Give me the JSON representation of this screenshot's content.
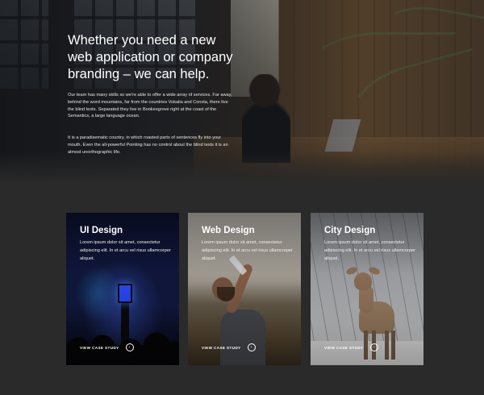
{
  "hero": {
    "headline": "Whether you need a new web application or company branding – we can help.",
    "paragraph1": "Our team has many skills so we're able to offer a wide array of services. Far away, behind the word mountains, far from the countries Vokalia and Consta, there live the blind texts. Separated they live in Bookesgrove right at the coast of the Semantics, a large language ocean.",
    "paragraph2": "It is a paradisematic country, in which roasted parts of sentences fly into your mouth. Even the all-powerful Pointing has no control about the blind texts it is an almost unorthographic life."
  },
  "cards": [
    {
      "title": "UI Design",
      "description": "Lorem ipsum dolor sit amet, consectetur adipiscing elit. In et arcu vel risus ullamcorper aliquet.",
      "cta_label": "VIEW CASE STUDY",
      "cta_icon": "chevron-right-icon"
    },
    {
      "title": "Web Design",
      "description": "Lorem ipsum dolor sit amet, consectetur adipiscing elit. In et arcu vel risus ullamcorper aliquet.",
      "cta_label": "VIEW CASE STUDY",
      "cta_icon": "chevron-right-icon"
    },
    {
      "title": "City Design",
      "description": "Lorem ipsum dolor sit amet, consectetur adipiscing elit. In et arcu vel risus ullamcorper aliquet.",
      "cta_label": "VIEW CASE STUDY",
      "cta_icon": "chevron-right-icon"
    }
  ],
  "colors": {
    "page_background": "#2a2a2a",
    "text": "#ffffff"
  }
}
